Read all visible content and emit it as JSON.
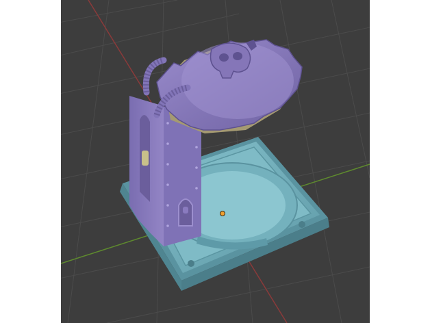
{
  "viewport": {
    "background": "#3d3d3d",
    "grid_color": "#4a4a4a",
    "axis_x_color": "#8a3a3a",
    "axis_y_color": "#5e8a2e",
    "origin_color": "#f0a030"
  },
  "scene": {
    "model_primary_color": "#8a7bbf",
    "model_shadow_color": "#6c5f9e",
    "base_color": "#7cb8c4",
    "base_shadow_color": "#5e9aa8",
    "trim_color": "#a59a72",
    "icons": [
      "skull-emblem-icon",
      "origin-point-icon"
    ]
  }
}
